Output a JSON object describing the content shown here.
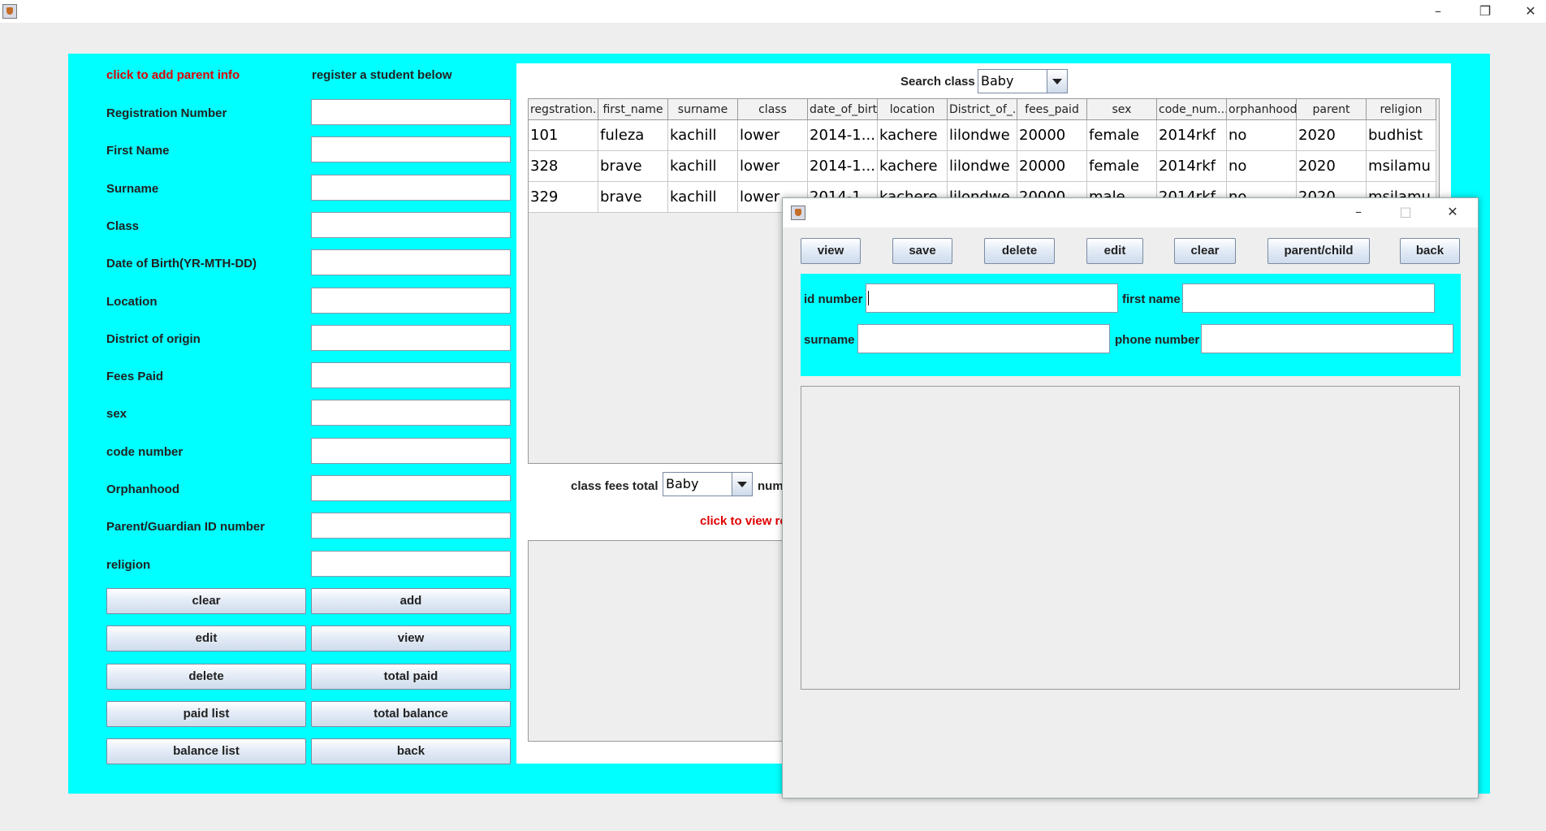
{
  "window": {
    "controls": {
      "minimize": "–",
      "restore": "❐",
      "close": "✕"
    }
  },
  "form": {
    "parent_link": "click to add parent info",
    "register_heading": "register a student below",
    "fields": [
      {
        "label": "Registration Number",
        "value": ""
      },
      {
        "label": "First Name",
        "value": ""
      },
      {
        "label": "Surname",
        "value": ""
      },
      {
        "label": "Class",
        "value": ""
      },
      {
        "label": "Date of Birth(YR-MTH-DD)",
        "value": ""
      },
      {
        "label": "Location",
        "value": ""
      },
      {
        "label": "District of origin",
        "value": ""
      },
      {
        "label": "Fees Paid",
        "value": ""
      },
      {
        "label": "sex",
        "value": ""
      },
      {
        "label": "code number",
        "value": ""
      },
      {
        "label": "Orphanhood",
        "value": ""
      },
      {
        "label": "Parent/Guardian ID number",
        "value": ""
      },
      {
        "label": "religion",
        "value": ""
      }
    ],
    "buttons": [
      [
        "clear",
        "add"
      ],
      [
        "edit",
        "view"
      ],
      [
        "delete",
        "total paid"
      ],
      [
        "paid list",
        "total balance"
      ],
      [
        "balance list",
        "back"
      ]
    ]
  },
  "search": {
    "label": "Search class",
    "selected": "Baby"
  },
  "table": {
    "columns": [
      "regstration...",
      "first_name",
      "surname",
      "class",
      "date_of_birth",
      "location",
      "District_of_...",
      "fees_paid",
      "sex",
      "code_num...",
      "orphanhood",
      "parent",
      "religion"
    ],
    "rows": [
      [
        "101",
        "fuleza",
        "kachill",
        "lower",
        "2014-1...",
        "kachere",
        "lilondwe",
        "20000",
        "female",
        "2014rkf",
        "no",
        "2020",
        "budhist"
      ],
      [
        "328",
        "brave",
        "kachill",
        "lower",
        "2014-1...",
        "kachere",
        "lilondwe",
        "20000",
        "female",
        "2014rkf",
        "no",
        "2020",
        "msilamu"
      ],
      [
        "329",
        "brave",
        "kachill",
        "lower",
        "2014-1...",
        "kachere",
        "lilondwe",
        "20000",
        "male",
        "2014rkf",
        "no",
        "2020",
        "msilamu"
      ]
    ]
  },
  "class_fees": {
    "label": "class fees total",
    "selected": "Baby",
    "num_label": "num"
  },
  "view_link": "click to view re",
  "dialog": {
    "buttons": [
      "view",
      "save",
      "delete",
      "edit",
      "clear",
      "parent/child",
      "back"
    ],
    "fields": {
      "id_label": "id number",
      "id_value": "",
      "first_label": "first name",
      "first_value": "",
      "surname_label": "surname",
      "surname_value": "",
      "phone_label": "phone number",
      "phone_value": ""
    },
    "controls": {
      "minimize": "–",
      "maximize": "□",
      "close": "✕"
    }
  }
}
